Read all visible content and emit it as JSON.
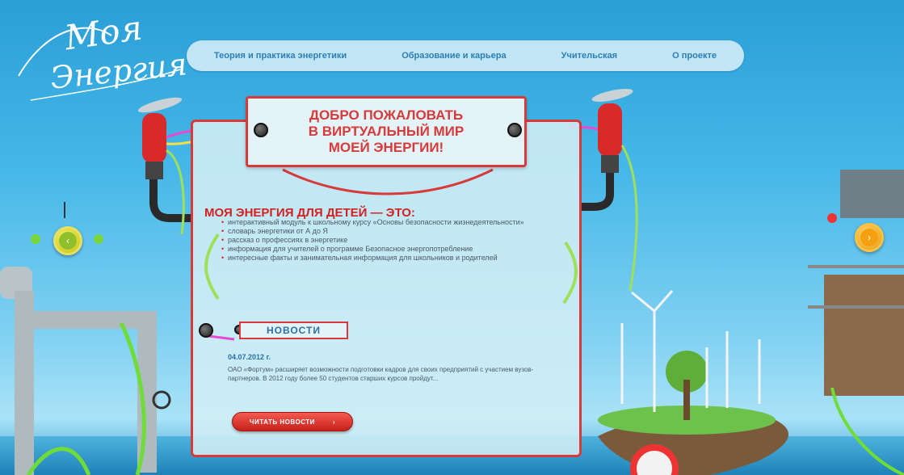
{
  "logo": {
    "line1": "Моя",
    "line2": "Энергия"
  },
  "nav": {
    "items": [
      {
        "label": "Теория и практика энергетики"
      },
      {
        "label": "Образование и карьера"
      },
      {
        "label": "Учительская"
      },
      {
        "label": "О проекте"
      }
    ]
  },
  "welcome": {
    "line1": "ДОБРО ПОЖАЛОВАТЬ",
    "line2": "В ВИРТУАЛЬНЫЙ МИР",
    "line3": "МОЕЙ ЭНЕРГИИ!"
  },
  "section": {
    "title": "МОЯ ЭНЕРГИЯ ДЛЯ ДЕТЕЙ — ЭТО:",
    "items": [
      "интерактивный модуль к школьному курсу «Основы безопасности жизнедеятельности»",
      "словарь энергетики от А до Я",
      "рассказ о профессиях в энергетике",
      "информация для учителей о программе Безопасное энергопотребление",
      "интересные факты и занимательная информация для школьников и родителей"
    ]
  },
  "news": {
    "tag": "НОВОСТИ",
    "date": "04.07.2012 г.",
    "text": "ОАО «Фортум» расширяет возможности подготовки кадров для своих предприятий с участием вузов-партнеров. В 2012 году более 50 студентов старших курсов пройдут...",
    "button_label": "ЧИТАТЬ НОВОСТИ",
    "button_arrow": "›"
  },
  "arrows": {
    "left": "‹",
    "right": "›"
  },
  "colors": {
    "accent": "#d83a3a",
    "sky": "#45b7e8",
    "nav_text": "#2c7fb5"
  }
}
